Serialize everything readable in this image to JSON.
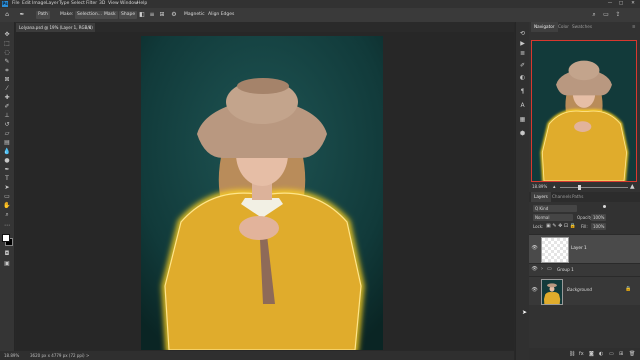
{
  "menubar": {
    "app_logo": "Ps",
    "items": [
      "File",
      "Edit",
      "Image",
      "Layer",
      "Type",
      "Select",
      "Filter",
      "3D",
      "View",
      "Window",
      "Help"
    ],
    "window_controls": [
      "—",
      "□",
      "✕"
    ]
  },
  "options_bar": {
    "mode_label": "Path",
    "make_label": "Make:",
    "selection_label": "Selection...",
    "mask_label": "Mask",
    "shape_label": "Shape",
    "magnetic_label": "Magnetic",
    "align_edges_label": "Align Edges"
  },
  "document": {
    "tab_title": "Lolyana.psd @ 19% (Layer 1, RGB/8) *",
    "tab_close": "×"
  },
  "status_bar": {
    "zoom": "18.89%",
    "doc_size": "3620 px x 4779 px (72 ppi)",
    "arrow": ">"
  },
  "panels": {
    "top_tabs": [
      "Navigator",
      "Color",
      "Swatches"
    ],
    "nav_zoom": "18.89%",
    "layers_tabs": [
      "Layers",
      "Channels",
      "Paths"
    ],
    "kind_filter": "Q Kind",
    "blend_mode": "Normal",
    "opacity_label": "Opacity:",
    "opacity_value": "100%",
    "lock_label": "Lock:",
    "fill_label": "Fill:",
    "fill_value": "100%",
    "layers": [
      {
        "name": "Layer 1",
        "visible": true,
        "selected": true
      },
      {
        "name": "Group 1",
        "visible": true,
        "selected": false
      },
      {
        "name": "Background",
        "visible": true,
        "selected": false,
        "locked": true
      }
    ]
  },
  "colors": {
    "accent": "#2b8fd9",
    "glow": "#ffd21c",
    "dress": "#e0ac2c",
    "backdrop": "#123d3e"
  }
}
